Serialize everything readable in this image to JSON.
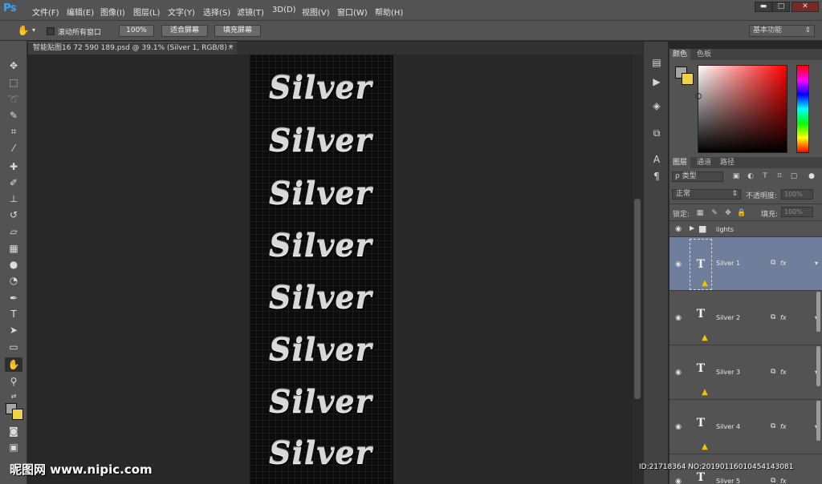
{
  "app": {
    "logo": "Ps"
  },
  "menu": [
    "文件(F)",
    "编辑(E)",
    "图像(I)",
    "图层(L)",
    "文字(Y)",
    "选择(S)",
    "滤镜(T)",
    "3D(D)",
    "视图(V)",
    "窗口(W)",
    "帮助(H)"
  ],
  "window_controls": {
    "minimize": "▬",
    "restore": "□",
    "close": "✕"
  },
  "options_bar": {
    "scroll_all_label": "滚动所有窗口",
    "zoom_button": "100%",
    "fit_screen_button": "适合屏幕",
    "fill_screen_button": "填充屏幕",
    "workspace": "基本功能"
  },
  "document_tab": {
    "title": "智能贴图16 72 590 189.psd @ 39.1% (Silver 1, RGB/8) *",
    "close": "×"
  },
  "document_text": [
    "Silver",
    "Silver",
    "Silver",
    "Silver",
    "Silver",
    "Silver",
    "Silver",
    "Silver"
  ],
  "color_panel": {
    "tabs": [
      "颜色",
      "色板"
    ],
    "foreground": "#a5a5a5",
    "background": "#f0d24a"
  },
  "layers_panel": {
    "tabs": [
      "图层",
      "通道",
      "路径"
    ],
    "filter_label": "ρ 类型",
    "blend_mode": "正常",
    "opacity_label": "不透明度:",
    "opacity_value": "100%",
    "lock_label": "锁定:",
    "fill_label": "填充:",
    "fill_value": "100%",
    "group": {
      "name": "lights"
    },
    "layers": [
      {
        "name": "Silver 1",
        "thumb": "T",
        "fx": "fx",
        "selected": true
      },
      {
        "name": "Silver 2",
        "thumb": "T",
        "fx": "fx",
        "selected": false
      },
      {
        "name": "Silver 3",
        "thumb": "T",
        "fx": "fx",
        "selected": false
      },
      {
        "name": "Silver 4",
        "thumb": "T",
        "fx": "fx",
        "selected": false
      },
      {
        "name": "Silver 5",
        "thumb": "T",
        "fx": "fx",
        "selected": false
      }
    ]
  },
  "watermark": {
    "left": "昵图网 www.nipic.com",
    "right": "ID:21718364 NO:20190116010454143081"
  }
}
